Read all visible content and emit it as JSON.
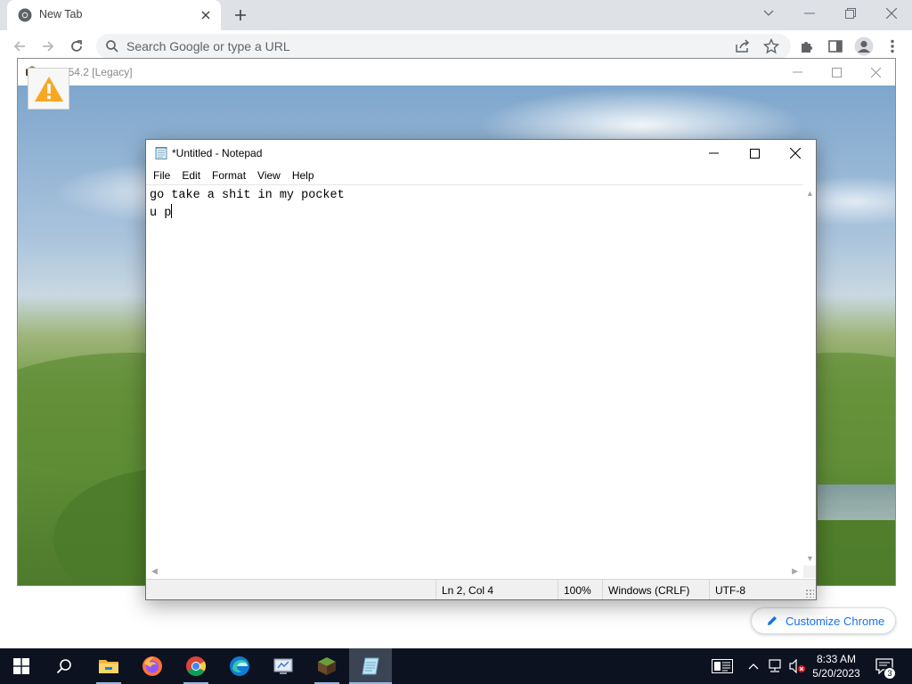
{
  "chrome": {
    "tab": {
      "title": "New Tab",
      "favicon": "chrome-icon"
    },
    "new_tab_icon": "plus-icon",
    "window_controls": [
      "tab-search-icon",
      "minimize-icon",
      "restore-icon",
      "close-icon"
    ],
    "toolbar": {
      "nav_icons": [
        "back-arrow-icon",
        "forward-arrow-icon",
        "reload-icon"
      ],
      "omnibox_placeholder": "Search Google or type a URL",
      "right_icons": [
        "share-icon",
        "bookmark-star-icon",
        "extensions-puzzle-icon",
        "side-panel-icon",
        "profile-icon",
        "kebab-menu-icon"
      ]
    },
    "customize_label": "Customize Chrome",
    "accent": "#1a73e8"
  },
  "tlauncher": {
    "title": "TL 154.2 [Legacy]",
    "icon": "minecraft-grass-block-icon",
    "warning_icon": "warning-triangle-icon",
    "warning_color": "#f7a823"
  },
  "notepad": {
    "title": "*Untitled - Notepad",
    "menu": [
      "File",
      "Edit",
      "Format",
      "View",
      "Help"
    ],
    "lines": [
      "go take a shit in my pocket",
      "u p"
    ],
    "status": {
      "position": "Ln 2, Col 4",
      "zoom": "100%",
      "line_ending": "Windows (CRLF)",
      "encoding": "UTF-8"
    }
  },
  "taskbar": {
    "apps": [
      "windows-start-icon",
      "search-icon",
      "file-explorer-icon",
      "firefox-icon",
      "chrome-icon",
      "edge-icon",
      "control-panel-icon",
      "minecraft-icon",
      "notepad-icon"
    ],
    "tray_icons": [
      "news-widget-icon",
      "chevron-up-icon",
      "network-icon",
      "volume-muted-icon"
    ],
    "time": "8:33 AM",
    "date": "5/20/2023",
    "notification_count": "3",
    "background": "#0c1220"
  }
}
